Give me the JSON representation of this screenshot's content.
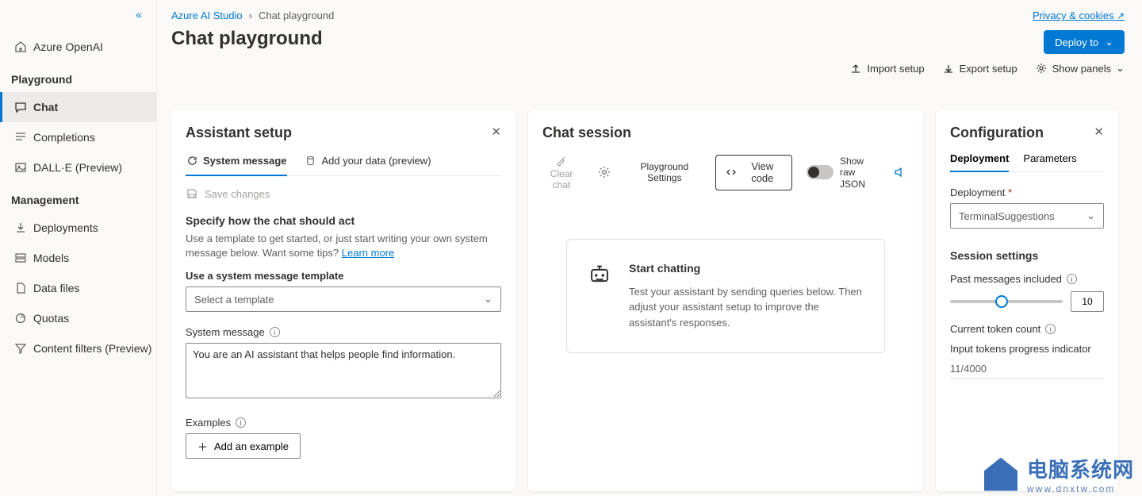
{
  "sidebar": {
    "topLink": "Azure OpenAI",
    "sectionPlayground": "Playground",
    "sectionManagement": "Management",
    "items": {
      "chat": "Chat",
      "completions": "Completions",
      "dalle": "DALL·E (Preview)",
      "deployments": "Deployments",
      "models": "Models",
      "datafiles": "Data files",
      "quotas": "Quotas",
      "contentfilters": "Content filters (Preview)"
    }
  },
  "breadcrumb": {
    "root": "Azure AI Studio",
    "current": "Chat playground",
    "sep": "›"
  },
  "pageTitle": "Chat playground",
  "topLinks": {
    "privacy": "Privacy & cookies"
  },
  "deployBtn": "Deploy to",
  "toolbar": {
    "import": "Import setup",
    "export": "Export setup",
    "showPanels": "Show panels"
  },
  "assistant": {
    "title": "Assistant setup",
    "tabSystem": "System message",
    "tabData": "Add your data (preview)",
    "save": "Save changes",
    "specifyHeading": "Specify how the chat should act",
    "specifyDesc": "Use a template to get started, or just start writing your own system message below. Want some tips? ",
    "learnMore": "Learn more",
    "templateLabel": "Use a system message template",
    "templatePlaceholder": "Select a template",
    "sysMsgLabel": "System message",
    "sysMsgText": "You are an AI assistant that helps people find information.",
    "examplesLabel": "Examples",
    "addExample": "Add an example"
  },
  "chat": {
    "title": "Chat session",
    "clear": "Clear chat",
    "settings": "Playground Settings",
    "viewCode": "View code",
    "rawJson": "Show raw JSON",
    "startTitle": "Start chatting",
    "startDesc": "Test your assistant by sending queries below. Then adjust your assistant setup to improve the assistant's responses."
  },
  "config": {
    "title": "Configuration",
    "tabDeployment": "Deployment",
    "tabParams": "Parameters",
    "deploymentLabel": "Deployment",
    "deploymentValue": "TerminalSuggestions",
    "sessionHeading": "Session settings",
    "pastMsgLabel": "Past messages included",
    "pastMsgValue": "10",
    "tokenLabel": "Current token count",
    "tokenDesc": "Input tokens progress indicator",
    "tokenCount": "11/4000"
  },
  "watermark": {
    "brand": "电脑系统网",
    "url": "www.dnxtw.com"
  }
}
